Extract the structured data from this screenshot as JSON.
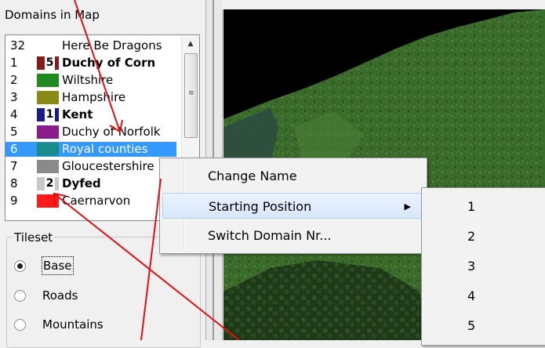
{
  "domains_panel": {
    "header": "Domains in Map",
    "rows": [
      {
        "num": "32",
        "name": "Here Be Dragons",
        "color": "",
        "badge": "",
        "bold": false
      },
      {
        "num": "1",
        "name": "Duchy of Corn",
        "color": "#8b1a1a",
        "badge": "5",
        "bold": true
      },
      {
        "num": "2",
        "name": "Wiltshire",
        "color": "#1f8a1f",
        "badge": "",
        "bold": false
      },
      {
        "num": "3",
        "name": "Hampshire",
        "color": "#8a8a14",
        "badge": "",
        "bold": false
      },
      {
        "num": "4",
        "name": "Kent",
        "color": "#1a1a8b",
        "badge": "1",
        "bold": true
      },
      {
        "num": "5",
        "name": "Duchy of Norfolk",
        "color": "#8b1a8b",
        "badge": "",
        "bold": false
      },
      {
        "num": "6",
        "name": "Royal counties",
        "color": "#1a8b8b",
        "badge": "",
        "bold": false,
        "selected": true
      },
      {
        "num": "7",
        "name": "Gloucestershire",
        "color": "#8a8a8a",
        "badge": "",
        "bold": false
      },
      {
        "num": "8",
        "name": "Dyfed",
        "color": "#c8c8c8",
        "badge": "2",
        "bold": true
      },
      {
        "num": "9",
        "name": "Caernarvon",
        "color": "#ff1a1a",
        "badge": "",
        "bold": false
      }
    ],
    "scroll_grip": "≡"
  },
  "tileset": {
    "legend": "Tileset",
    "options": [
      {
        "label": "Base",
        "selected": true
      },
      {
        "label": "Roads",
        "selected": false
      },
      {
        "label": "Mountains",
        "selected": false
      }
    ]
  },
  "context_menu": {
    "items": [
      {
        "label": "Change Name",
        "has_submenu": false
      },
      {
        "label": "Starting Position",
        "has_submenu": true,
        "arrow": "▶"
      },
      {
        "label": "Switch Domain Nr...",
        "has_submenu": false
      }
    ]
  },
  "submenu": {
    "items": [
      "1",
      "2",
      "3",
      "4",
      "5"
    ]
  },
  "colors": {
    "selection": "#3399ff",
    "annotation": "#e01010",
    "map_grass": "#3b6b2a"
  },
  "icons": {
    "scroll_up": "chevron-up-icon",
    "submenu_arrow": "chevron-right-icon"
  }
}
